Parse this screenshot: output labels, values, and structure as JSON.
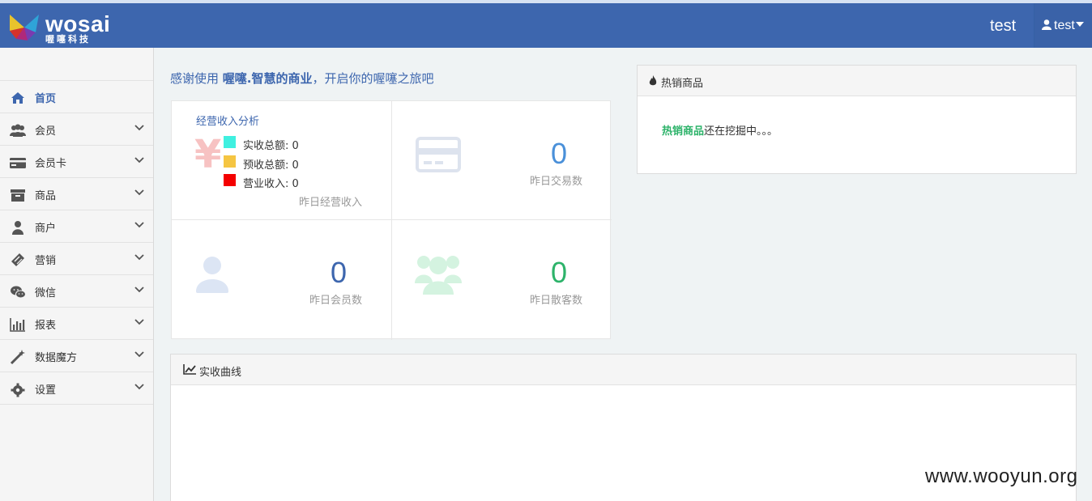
{
  "topbar": {
    "logo_text": "wosai",
    "logo_sub": "喔噻科技",
    "username": "test",
    "user_menu_label": "test"
  },
  "sidebar": {
    "items": [
      {
        "label": "首页",
        "icon": "home-icon",
        "active": true
      },
      {
        "label": "会员",
        "icon": "users-icon"
      },
      {
        "label": "会员卡",
        "icon": "credit-card-icon"
      },
      {
        "label": "商品",
        "icon": "archive-icon"
      },
      {
        "label": "商户",
        "icon": "user-icon"
      },
      {
        "label": "营销",
        "icon": "ticket-icon"
      },
      {
        "label": "微信",
        "icon": "wechat-icon"
      },
      {
        "label": "报表",
        "icon": "bar-chart-icon"
      },
      {
        "label": "数据魔方",
        "icon": "magic-wand-icon"
      },
      {
        "label": "设置",
        "icon": "gear-icon"
      }
    ]
  },
  "welcome": {
    "prefix": "感谢使用 ",
    "brand": "喔噻.智慧的商业",
    "suffix": "，开启你的喔噻之旅吧"
  },
  "stats": {
    "income": {
      "title": "经营收入分析",
      "symbol": "¥",
      "legend": [
        {
          "label": "实收总额: 0",
          "color": "#3ff0e0"
        },
        {
          "label": "预收总额: 0",
          "color": "#f5c542"
        },
        {
          "label": "营业收入: 0",
          "color": "#f40000"
        }
      ],
      "caption": "昨日经营收入"
    },
    "transactions": {
      "value": "0",
      "caption": "昨日交易数",
      "color": "#4a90d9"
    },
    "members": {
      "value": "0",
      "caption": "昨日会员数",
      "color": "#3d66ae"
    },
    "walkins": {
      "value": "0",
      "caption": "昨日散客数",
      "color": "#2db36a"
    }
  },
  "hot_products": {
    "title": "热销商品",
    "highlight": "热销商品",
    "message": "还在挖掘中。。。"
  },
  "revenue_curve": {
    "title": "实收曲线"
  },
  "watermark": "www.wooyun.org"
}
